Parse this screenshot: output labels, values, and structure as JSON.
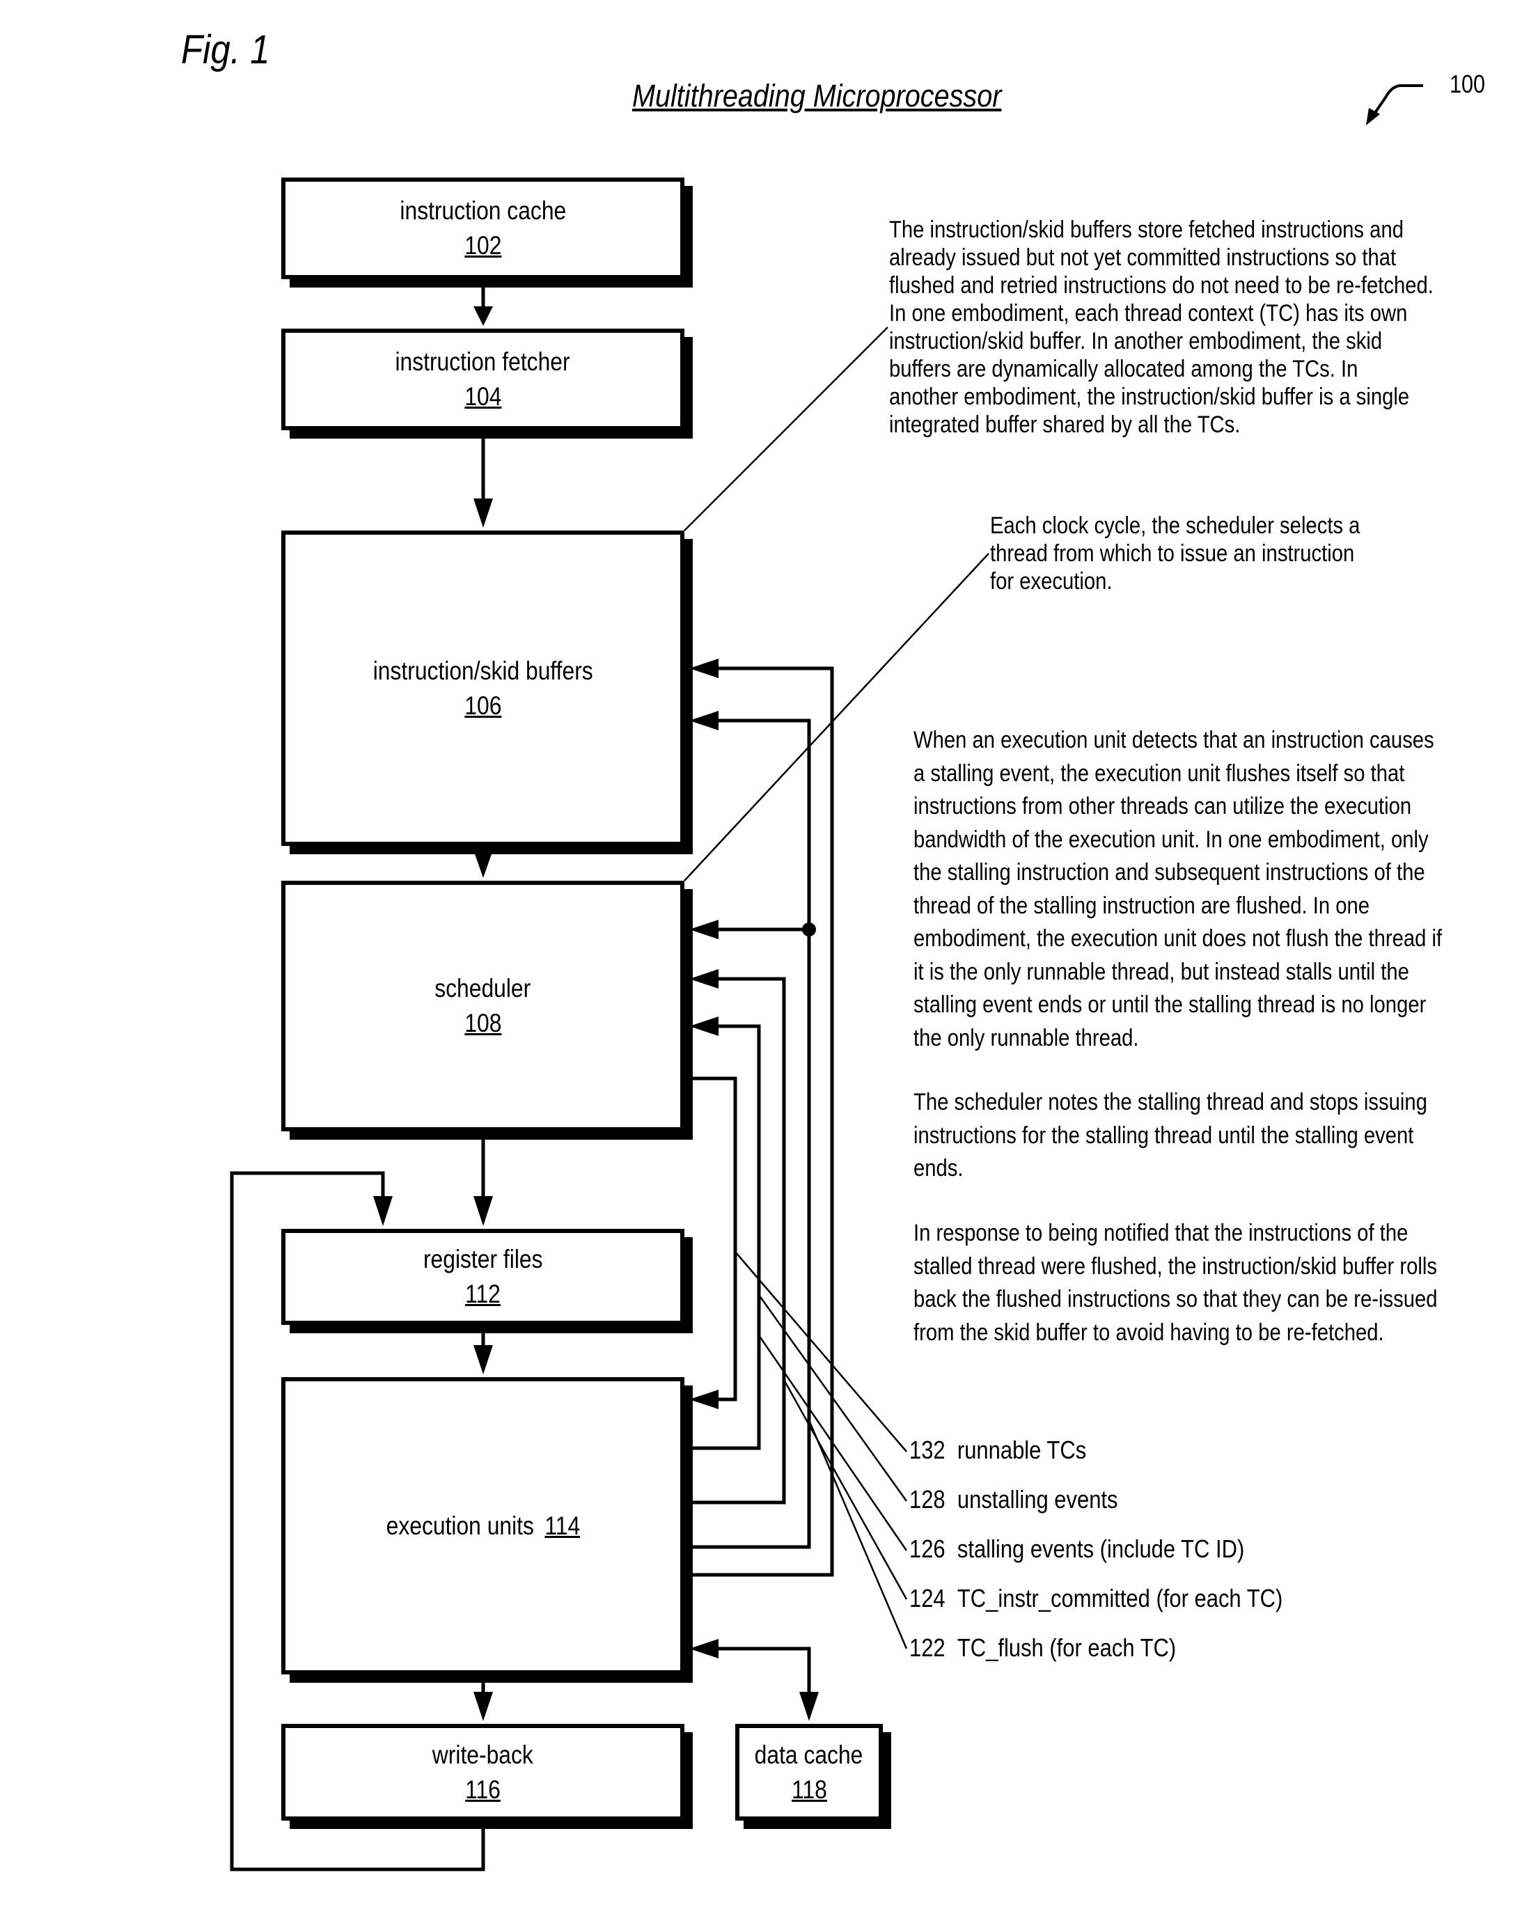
{
  "figure": {
    "label": "Fig. 1",
    "title": "Multithreading Microprocessor",
    "reference_number": "100"
  },
  "blocks": {
    "instruction_cache": {
      "label": "instruction cache",
      "number": "102"
    },
    "instruction_fetcher": {
      "label": "instruction fetcher",
      "number": "104"
    },
    "skid_buffers": {
      "label": "instruction/skid buffers",
      "number": "106"
    },
    "scheduler": {
      "label": "scheduler",
      "number": "108"
    },
    "register_files": {
      "label": "register files",
      "number": "112"
    },
    "execution_units": {
      "label": "execution units",
      "number": "114"
    },
    "write_back": {
      "label": "write-back",
      "number": "116"
    },
    "data_cache": {
      "label": "data cache",
      "number": "118"
    }
  },
  "notes": {
    "skid_buffers": "The instruction/skid buffers store fetched instructions and\nalready issued but not yet committed instructions so that\nflushed and retried instructions do not need to be re-fetched.\nIn one embodiment, each thread context (TC) has its own\ninstruction/skid buffer.  In another embodiment, the skid\nbuffers are dynamically allocated among the TCs.  In\nanother embodiment, the instruction/skid buffer is a single\nintegrated buffer shared by all the TCs.",
    "scheduler": "Each clock cycle, the scheduler selects a\nthread from which to issue an instruction\nfor execution.",
    "stall_flush": "When an execution unit detects that an instruction causes\na stalling event, the execution unit flushes itself so that\ninstructions from other threads can utilize the execution\nbandwidth of the execution unit.  In one embodiment, only\nthe stalling instruction and subsequent instructions of the\nthread of the stalling instruction are flushed.  In one\nembodiment, the execution unit does not flush the thread if\nit is the only runnable thread, but instead stalls until the\nstalling event ends or until the stalling thread is no longer\nthe only runnable thread.",
    "scheduler_stall": "The scheduler notes the stalling thread and stops issuing\ninstructions for the stalling thread until the  stalling event\nends.",
    "rollback": "In response to being notified that the instructions of the\nstalled thread were flushed, the instruction/skid buffer rolls\nback the flushed instructions so that they can be re-issued\nfrom the skid buffer to avoid having to be re-fetched."
  },
  "signals": [
    {
      "number": "132",
      "label": "runnable TCs"
    },
    {
      "number": "128",
      "label": "unstalling events"
    },
    {
      "number": "126",
      "label": "stalling events (include TC ID)"
    },
    {
      "number": "124",
      "label": "TC_instr_committed (for each TC)"
    },
    {
      "number": "122",
      "label": "TC_flush (for each TC)"
    }
  ]
}
